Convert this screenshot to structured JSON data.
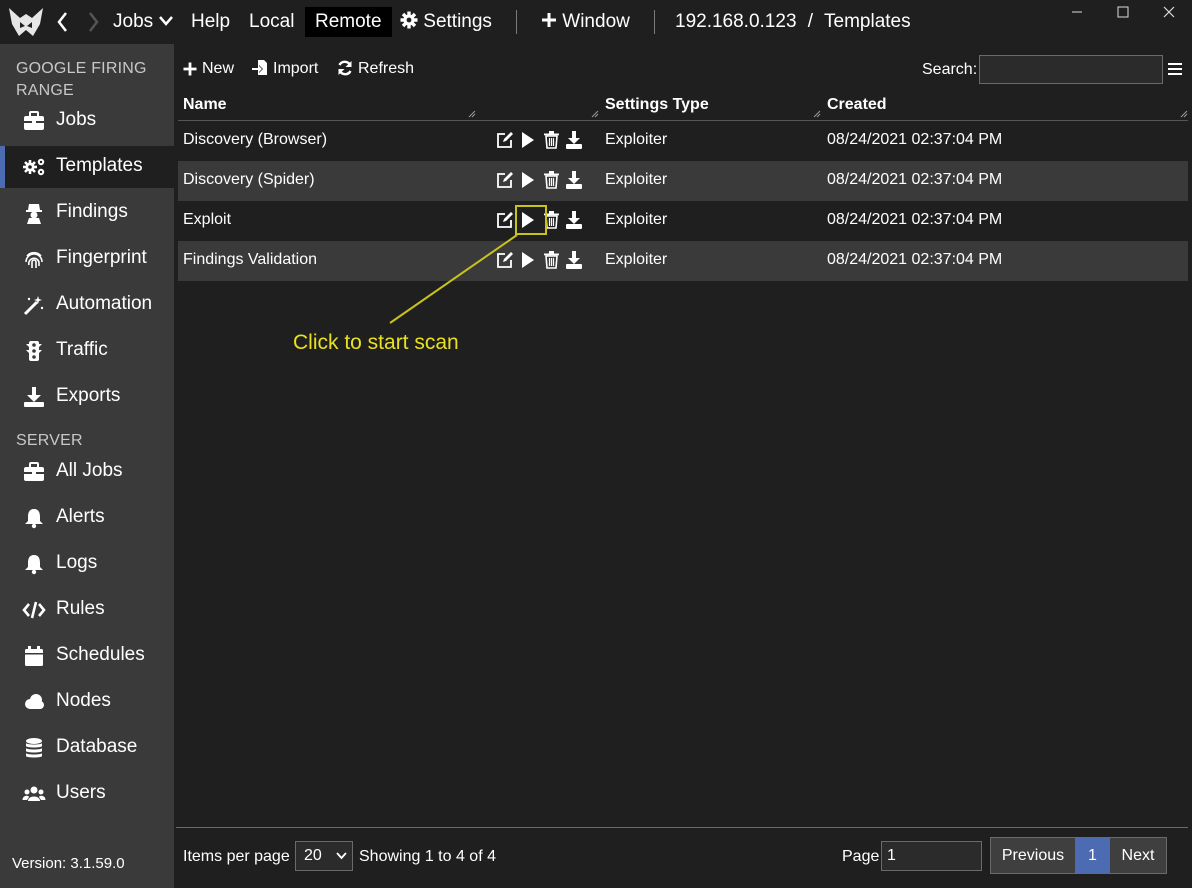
{
  "titlebar": {
    "menu": [
      {
        "label": "Jobs"
      },
      {
        "label": "Help"
      },
      {
        "label": "Local"
      },
      {
        "label": "Remote"
      },
      {
        "label": "Settings"
      },
      {
        "label": "Window"
      }
    ],
    "host": "192.168.0.123",
    "separator": "/",
    "page": "Templates"
  },
  "sidebar": {
    "section1": "GOOGLE FIRING RANGE",
    "section2": "SERVER",
    "items": [
      {
        "label": "Jobs",
        "icon": "briefcase-icon"
      },
      {
        "label": "Templates",
        "icon": "cogs-icon"
      },
      {
        "label": "Findings",
        "icon": "user-secret-icon"
      },
      {
        "label": "Fingerprint",
        "icon": "fingerprint-icon"
      },
      {
        "label": "Automation",
        "icon": "magic-wand-icon"
      },
      {
        "label": "Traffic",
        "icon": "traffic-light-icon"
      },
      {
        "label": "Exports",
        "icon": "download-icon"
      }
    ],
    "server_items": [
      {
        "label": "All Jobs",
        "icon": "briefcase-icon"
      },
      {
        "label": "Alerts",
        "icon": "bell-icon"
      },
      {
        "label": "Logs",
        "icon": "bell-icon"
      },
      {
        "label": "Rules",
        "icon": "code-icon"
      },
      {
        "label": "Schedules",
        "icon": "calendar-icon"
      },
      {
        "label": "Nodes",
        "icon": "cloud-icon"
      },
      {
        "label": "Database",
        "icon": "database-icon"
      },
      {
        "label": "Users",
        "icon": "users-icon"
      }
    ],
    "version": "Version: 3.1.59.0"
  },
  "toolbar": {
    "new_label": "New",
    "import_label": "Import",
    "refresh_label": "Refresh",
    "search_label": "Search:",
    "search_value": ""
  },
  "table": {
    "columns": [
      "Name",
      "Settings Type",
      "Created"
    ],
    "rows": [
      {
        "name": "Discovery (Browser)",
        "type": "Exploiter",
        "created": "08/24/2021 02:37:04 PM"
      },
      {
        "name": "Discovery (Spider)",
        "type": "Exploiter",
        "created": "08/24/2021 02:37:04 PM"
      },
      {
        "name": "Exploit",
        "type": "Exploiter",
        "created": "08/24/2021 02:37:04 PM"
      },
      {
        "name": "Findings Validation",
        "type": "Exploiter",
        "created": "08/24/2021 02:37:04 PM"
      }
    ]
  },
  "annotation": {
    "text": "Click to start scan",
    "color": "#e8e020"
  },
  "footer": {
    "items_per_page_label": "Items per page",
    "items_per_page_value": "20",
    "showing": "Showing 1 to 4 of 4",
    "page_label": "Page",
    "page_value": "1",
    "previous": "Previous",
    "current_page": "1",
    "next": "Next"
  },
  "colors": {
    "accent": "#4d6bb3",
    "sidebar_bg": "#3a3a3a",
    "main_bg": "#1f1f1f",
    "annotation": "#e8e020"
  }
}
